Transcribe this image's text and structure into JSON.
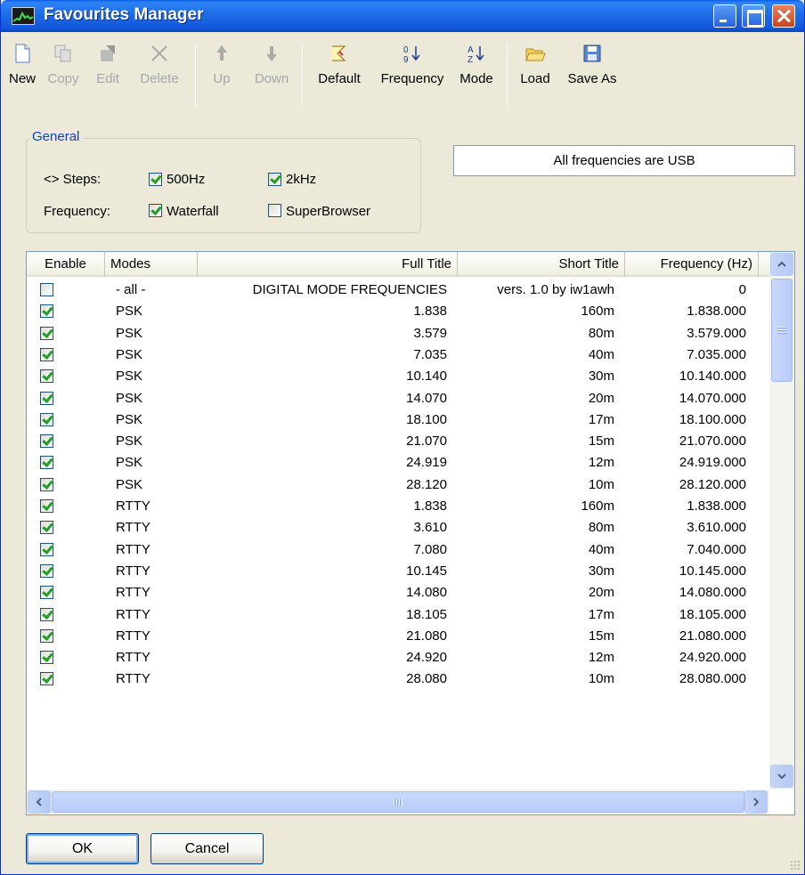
{
  "window": {
    "title": "Favourites Manager"
  },
  "toolbar": [
    {
      "label": "New",
      "icon": "new-document-icon",
      "enabled": true
    },
    {
      "label": "Copy",
      "icon": "copy-icon",
      "enabled": false
    },
    {
      "label": "Edit",
      "icon": "edit-icon",
      "enabled": false
    },
    {
      "label": "Delete",
      "icon": "delete-x-icon",
      "enabled": false
    },
    {
      "label": "Up",
      "icon": "arrow-up-icon",
      "enabled": false
    },
    {
      "label": "Down",
      "icon": "arrow-down-icon",
      "enabled": false
    },
    {
      "label": "Default",
      "icon": "default-icon",
      "enabled": true
    },
    {
      "label": "Frequency",
      "icon": "sort-numeric-icon",
      "enabled": true
    },
    {
      "label": "Mode",
      "icon": "sort-alpha-icon",
      "enabled": true
    },
    {
      "label": "Load",
      "icon": "folder-open-icon",
      "enabled": true
    },
    {
      "label": "Save As",
      "icon": "floppy-disk-icon",
      "enabled": true
    }
  ],
  "general": {
    "title": "General",
    "steps_label": "<> Steps:",
    "frequency_label": "Frequency:",
    "opt_500hz": {
      "label": "500Hz",
      "checked": true
    },
    "opt_2khz": {
      "label": "2kHz",
      "checked": true
    },
    "opt_waterfall": {
      "label": "Waterfall",
      "checked": true
    },
    "opt_superbrowser": {
      "label": "SuperBrowser",
      "checked": false
    }
  },
  "info_text": "All frequencies are USB",
  "grid": {
    "columns": [
      "Enable",
      "Modes",
      "Full Title",
      "Short Title",
      "Frequency (Hz)"
    ],
    "rows": [
      {
        "enable": false,
        "mode": "- all -",
        "full": "DIGITAL MODE FREQUENCIES",
        "short": "vers. 1.0 by iw1awh",
        "freq": "0"
      },
      {
        "enable": true,
        "mode": "PSK",
        "full": "1.838",
        "short": "160m",
        "freq": "1.838.000"
      },
      {
        "enable": true,
        "mode": "PSK",
        "full": "3.579",
        "short": "80m",
        "freq": "3.579.000"
      },
      {
        "enable": true,
        "mode": "PSK",
        "full": "7.035",
        "short": "40m",
        "freq": "7.035.000"
      },
      {
        "enable": true,
        "mode": "PSK",
        "full": "10.140",
        "short": "30m",
        "freq": "10.140.000"
      },
      {
        "enable": true,
        "mode": "PSK",
        "full": "14.070",
        "short": "20m",
        "freq": "14.070.000"
      },
      {
        "enable": true,
        "mode": "PSK",
        "full": "18.100",
        "short": "17m",
        "freq": "18.100.000"
      },
      {
        "enable": true,
        "mode": "PSK",
        "full": "21.070",
        "short": "15m",
        "freq": "21.070.000"
      },
      {
        "enable": true,
        "mode": "PSK",
        "full": "24.919",
        "short": "12m",
        "freq": "24.919.000"
      },
      {
        "enable": true,
        "mode": "PSK",
        "full": "28.120",
        "short": "10m",
        "freq": "28.120.000"
      },
      {
        "enable": true,
        "mode": "RTTY",
        "full": "1.838",
        "short": "160m",
        "freq": "1.838.000"
      },
      {
        "enable": true,
        "mode": "RTTY",
        "full": "3.610",
        "short": "80m",
        "freq": "3.610.000"
      },
      {
        "enable": true,
        "mode": "RTTY",
        "full": "7.080",
        "short": "40m",
        "freq": "7.040.000"
      },
      {
        "enable": true,
        "mode": "RTTY",
        "full": "10.145",
        "short": "30m",
        "freq": "10.145.000"
      },
      {
        "enable": true,
        "mode": "RTTY",
        "full": "14.080",
        "short": "20m",
        "freq": "14.080.000"
      },
      {
        "enable": true,
        "mode": "RTTY",
        "full": "18.105",
        "short": "17m",
        "freq": "18.105.000"
      },
      {
        "enable": true,
        "mode": "RTTY",
        "full": "21.080",
        "short": "15m",
        "freq": "21.080.000"
      },
      {
        "enable": true,
        "mode": "RTTY",
        "full": "24.920",
        "short": "12m",
        "freq": "24.920.000"
      },
      {
        "enable": true,
        "mode": "RTTY",
        "full": "28.080",
        "short": "10m",
        "freq": "28.080.000"
      }
    ]
  },
  "buttons": {
    "ok": "OK",
    "cancel": "Cancel"
  },
  "colors": {
    "titlebar": "#1f6fe8",
    "checkmark": "#21a121",
    "disabled_text": "#a7a6aa"
  }
}
